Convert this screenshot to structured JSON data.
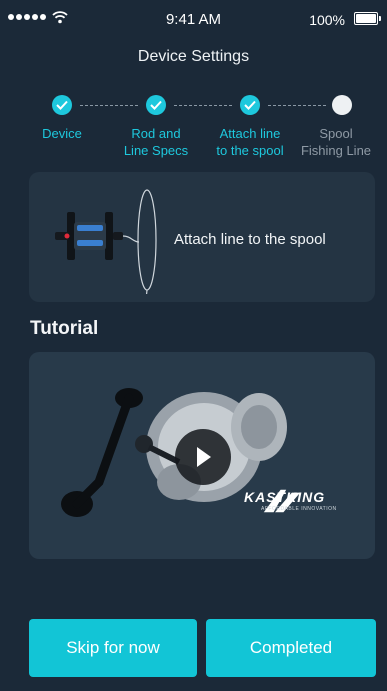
{
  "status_bar": {
    "time": "9:41 AM",
    "battery_percent": "100%"
  },
  "header": {
    "title": "Device Settings"
  },
  "stepper": {
    "steps": [
      {
        "label_line1": "Device",
        "label_line2": "",
        "state": "done"
      },
      {
        "label_line1": "Rod and",
        "label_line2": "Line Specs",
        "state": "done"
      },
      {
        "label_line1": "Attach line",
        "label_line2": "to the spool",
        "state": "done"
      },
      {
        "label_line1": "Spool",
        "label_line2": "Fishing Line",
        "state": "pending"
      }
    ]
  },
  "attach_card": {
    "text": "Attach line to the spool"
  },
  "tutorial": {
    "heading": "Tutorial",
    "brand_name": "KASTKING",
    "brand_tagline": "AFFORDABLE INNOVATION"
  },
  "actions": {
    "skip_label": "Skip for now",
    "complete_label": "Completed"
  },
  "colors": {
    "background": "#1b2938",
    "card": "#243443",
    "accent": "#1ec8dd",
    "button": "#12c5d6"
  },
  "icons": [
    "signal-dots-icon",
    "wifi-icon",
    "battery-icon",
    "check-icon",
    "play-icon"
  ]
}
